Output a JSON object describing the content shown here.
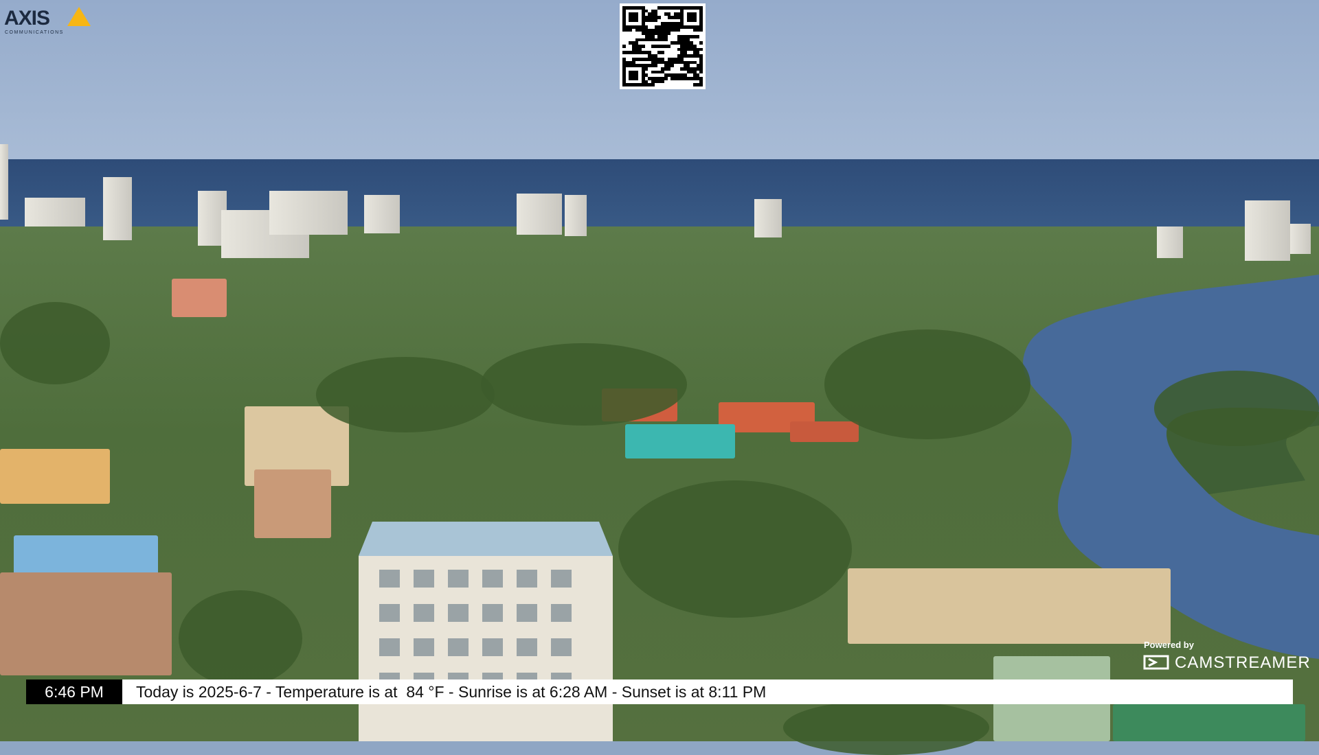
{
  "logo": {
    "brand": "AXIS",
    "subtitle": "COMMUNICATIONS"
  },
  "overlay": {
    "time": "6:46 PM",
    "message": "Today is 2025-6-7 - Temperature is at  84 °F - Sunrise is at 6:28 AM - Sunset is at 8:11 PM"
  },
  "powered_by": {
    "label": "Powered by",
    "name": "CAMSTREAMER"
  },
  "colors": {
    "accent_yellow": "#f7b614",
    "ticker_bg": "#ffffff",
    "time_bg": "#000000"
  },
  "icons": [
    "axis-logo-triangle",
    "qr-code",
    "camstreamer-logo-icon"
  ]
}
